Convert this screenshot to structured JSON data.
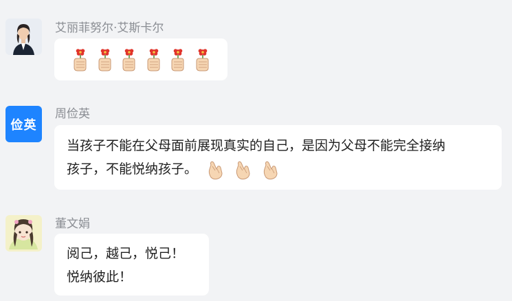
{
  "messages": [
    {
      "sender": "艾丽菲努尔·艾斯卡尔",
      "avatar": "portrait-photo-avatar",
      "content_emoji": [
        "rose-hand-emoji",
        "rose-hand-emoji",
        "rose-hand-emoji",
        "rose-hand-emoji",
        "rose-hand-emoji",
        "rose-hand-emoji"
      ]
    },
    {
      "sender": "周俭英",
      "avatar_text": "俭英",
      "avatar_color": "#1e84ff",
      "line1": "当孩子不能在父母面前展现真实的自己，是因为父母不能完全接纳",
      "line2": "孩子，不能悦纳孩子。",
      "trailing_emoji": [
        "finger-heart-emoji",
        "finger-heart-emoji",
        "finger-heart-emoji"
      ]
    },
    {
      "sender": "董文娟",
      "avatar": "illustrated-girl-avatar",
      "line1": "阅己，越己，悦己！",
      "line2": "悦纳彼此！"
    }
  ],
  "colors": {
    "background": "#f2f3f5",
    "bubble": "#ffffff",
    "sender_text": "#8a8d93",
    "message_text": "#1f1f1f"
  }
}
